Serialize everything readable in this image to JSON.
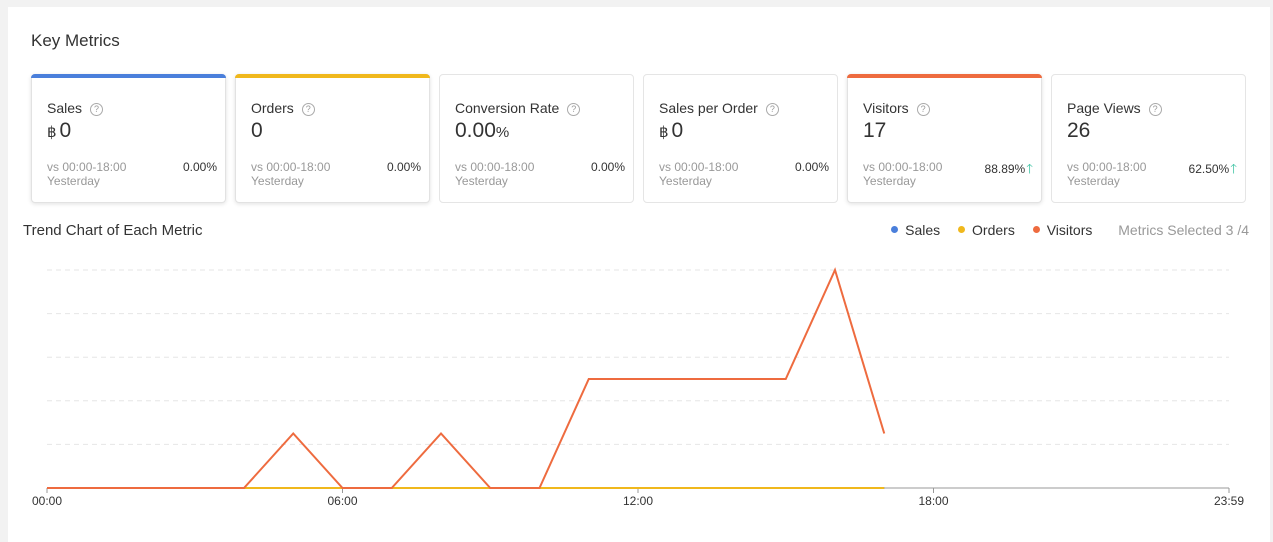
{
  "header": {
    "title": "Key Metrics"
  },
  "metrics": [
    {
      "label": "Sales",
      "currency": "฿",
      "value": "0",
      "unit": "",
      "compare": "vs 00:00-18:00",
      "compare2": "Yesterday",
      "change": "0.00%",
      "up": false,
      "accent": "#4a7fdb",
      "selected": true
    },
    {
      "label": "Orders",
      "currency": "",
      "value": "0",
      "unit": "",
      "compare": "vs 00:00-18:00",
      "compare2": "Yesterday",
      "change": "0.00%",
      "up": false,
      "accent": "#f0b81c",
      "selected": true
    },
    {
      "label": "Conversion Rate",
      "currency": "",
      "value": "0.00",
      "unit": "%",
      "compare": "vs 00:00-18:00",
      "compare2": "Yesterday",
      "change": "0.00%",
      "up": false,
      "accent": "",
      "selected": false
    },
    {
      "label": "Sales per Order",
      "currency": "฿",
      "value": "0",
      "unit": "",
      "compare": "vs 00:00-18:00",
      "compare2": "Yesterday",
      "change": "0.00%",
      "up": false,
      "accent": "",
      "selected": false
    },
    {
      "label": "Visitors",
      "currency": "",
      "value": "17",
      "unit": "",
      "compare": "vs 00:00-18:00",
      "compare2": "Yesterday",
      "change": "88.89%",
      "up": true,
      "accent": "#ee6b3f",
      "selected": true
    },
    {
      "label": "Page Views",
      "currency": "",
      "value": "26",
      "unit": "",
      "compare": "vs 00:00-18:00",
      "compare2": "Yesterday",
      "change": "62.50%",
      "up": true,
      "accent": "",
      "selected": false
    }
  ],
  "help_glyph": "?",
  "up_arrow": "🡑",
  "trend": {
    "title": "Trend Chart of Each Metric",
    "legend": [
      {
        "name": "Sales",
        "color": "#4a7fdb"
      },
      {
        "name": "Orders",
        "color": "#f0b81c"
      },
      {
        "name": "Visitors",
        "color": "#ee6b3f"
      }
    ],
    "metrics_selected": "Metrics Selected 3 /4"
  },
  "chart_data": {
    "type": "line",
    "title": "Trend Chart of Each Metric",
    "xlabel": "",
    "ylabel": "",
    "x_ticks": [
      "00:00",
      "06:00",
      "12:00",
      "18:00",
      "23:59"
    ],
    "x_range": [
      0,
      24
    ],
    "ylim": [
      0,
      4
    ],
    "grid": true,
    "legend_position": "top-right",
    "hours": [
      0,
      1,
      2,
      3,
      4,
      5,
      6,
      7,
      8,
      9,
      10,
      11,
      12,
      13,
      14,
      15,
      16,
      17
    ],
    "series": [
      {
        "name": "Sales",
        "color": "#4a7fdb",
        "values": [
          0,
          0,
          0,
          0,
          0,
          0,
          0,
          0,
          0,
          0,
          0,
          0,
          0,
          0,
          0,
          0,
          0,
          0
        ]
      },
      {
        "name": "Orders",
        "color": "#f0b81c",
        "values": [
          0,
          0,
          0,
          0,
          0,
          0,
          0,
          0,
          0,
          0,
          0,
          0,
          0,
          0,
          0,
          0,
          0,
          0
        ]
      },
      {
        "name": "Visitors",
        "color": "#ee6b3f",
        "values": [
          0,
          0,
          0,
          0,
          0,
          1,
          0,
          0,
          1,
          0,
          0,
          2,
          2,
          2,
          2,
          2,
          4,
          1
        ]
      }
    ]
  }
}
